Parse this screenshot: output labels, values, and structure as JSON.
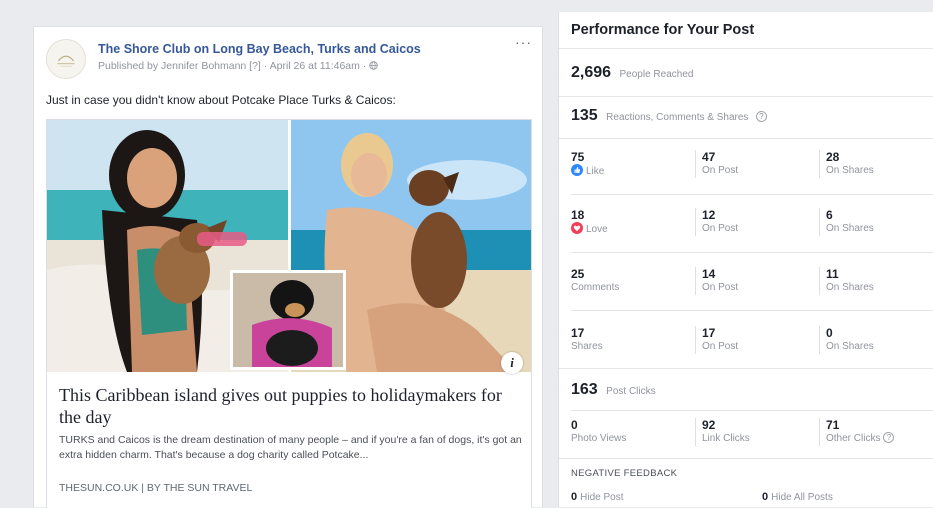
{
  "post": {
    "page_name": "The Shore Club on Long Bay Beach, Turks and Caicos",
    "meta": "Published by Jennifer Bohmann [?] · April 26 at 11:46am · ",
    "globe_icon": "globe-icon",
    "more_icon": "···",
    "text": "Just in case you didn't know about Potcake Place Turks & Caicos:",
    "link": {
      "info_icon": "i",
      "title": "This Caribbean island gives out puppies to holidaymakers for the day",
      "description": "TURKS and Caicos is the dream destination of many people – and if you're a fan of dogs, it's got an extra hidden charm. That's because a dog charity called Potcake...",
      "source": "THESUN.CO.UK | BY THE SUN TRAVEL"
    }
  },
  "insights": {
    "title": "Performance for Your Post",
    "reached": {
      "value": "2,696",
      "label": "People Reached"
    },
    "engagement": {
      "value": "135",
      "label": "Reactions, Comments & Shares",
      "icon": "?"
    },
    "rows": [
      {
        "value": "75",
        "label": "Like",
        "icon": "like-icon",
        "on_post": "47",
        "on_post_label": "On Post",
        "on_shares": "28",
        "on_shares_label": "On Shares"
      },
      {
        "value": "18",
        "label": "Love",
        "icon": "love-icon",
        "on_post": "12",
        "on_post_label": "On Post",
        "on_shares": "6",
        "on_shares_label": "On Shares"
      },
      {
        "value": "25",
        "label": "Comments",
        "icon": "",
        "on_post": "14",
        "on_post_label": "On Post",
        "on_shares": "11",
        "on_shares_label": "On Shares"
      },
      {
        "value": "17",
        "label": "Shares",
        "icon": "",
        "on_post": "17",
        "on_post_label": "On Post",
        "on_shares": "0",
        "on_shares_label": "On Shares"
      }
    ],
    "clicks": {
      "value": "163",
      "label": "Post Clicks"
    },
    "click_breakdown": [
      {
        "value": "0",
        "label": "Photo Views"
      },
      {
        "value": "92",
        "label": "Link Clicks"
      },
      {
        "value": "71",
        "label": "Other Clicks",
        "icon": "?"
      }
    ],
    "negative": {
      "title": "NEGATIVE FEEDBACK",
      "hide_post": {
        "value": "0",
        "label": "Hide Post"
      },
      "hide_all": {
        "value": "0",
        "label": "Hide All Posts"
      }
    }
  },
  "colors": {
    "link": "#365899",
    "like": "#2d88ff",
    "love": "#f33e58",
    "muted": "#90949c"
  }
}
